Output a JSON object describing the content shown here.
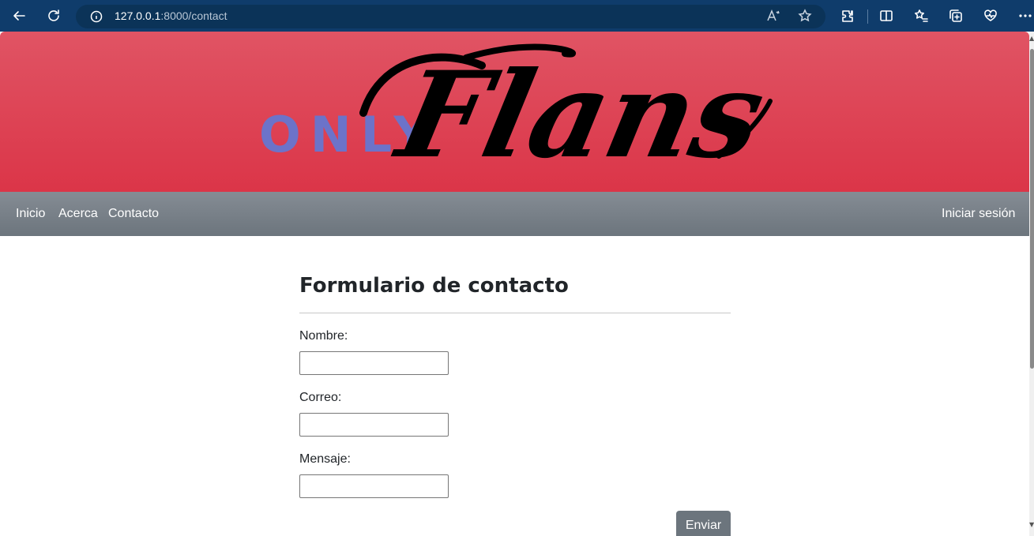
{
  "browser": {
    "url_host": "127.0.0.1",
    "url_path": ":8000/contact"
  },
  "header": {
    "logo_small": "ONLY",
    "logo_script": "Flans"
  },
  "nav": {
    "items": [
      {
        "label": "Inicio"
      },
      {
        "label": "Acerca"
      },
      {
        "label": "Contacto"
      }
    ],
    "login_label": "Iniciar sesión"
  },
  "form": {
    "title": "Formulario de contacto",
    "fields": [
      {
        "label": "Nombre:",
        "value": ""
      },
      {
        "label": "Correo:",
        "value": ""
      },
      {
        "label": "Mensaje:",
        "value": ""
      }
    ],
    "submit_label": "Enviar"
  },
  "colors": {
    "chrome": "#0f3c6b",
    "banner": "#db3548",
    "logo_only": "#6c73c9",
    "navbar": "#6c757d",
    "button": "#6c757d"
  }
}
